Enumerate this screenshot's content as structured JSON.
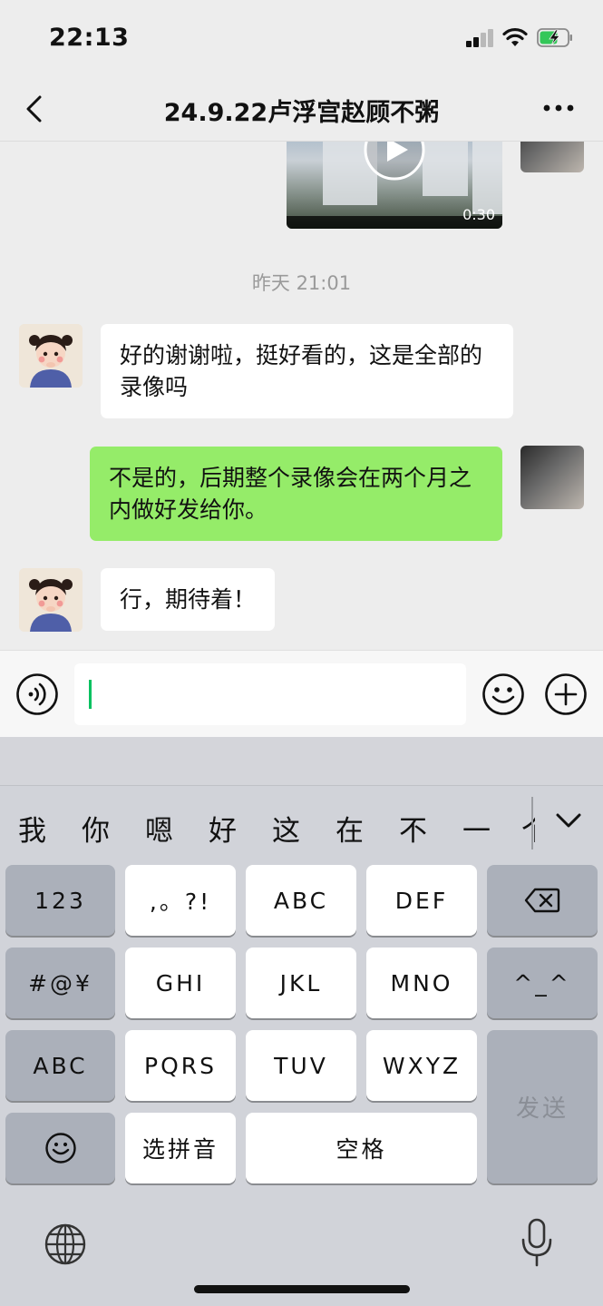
{
  "status_bar": {
    "time": "22:13"
  },
  "nav": {
    "title": "24.9.22卢浮宫赵顾不粥"
  },
  "chat": {
    "video": {
      "duration": "0:30"
    },
    "time_divider": "昨天 21:01",
    "messages": [
      {
        "from": "friend",
        "text": "好的谢谢啦，挺好看的，这是全部的录像吗"
      },
      {
        "from": "self",
        "text": "不是的，后期整个录像会在两个月之内做好发给你。"
      },
      {
        "from": "friend",
        "text": "行，期待着！"
      }
    ]
  },
  "input": {
    "value": ""
  },
  "keyboard": {
    "candidates": [
      "我",
      "你",
      "嗯",
      "好",
      "这",
      "在",
      "不",
      "一",
      "个"
    ],
    "keys": {
      "num": "123",
      "punct": ",。?!",
      "abc": "ABC",
      "def": "DEF",
      "symbols": "#@¥",
      "ghi": "GHI",
      "jkl": "JKL",
      "mno": "MNO",
      "kaomoji": "^_^",
      "abc_switch": "ABC",
      "pqrs": "PQRS",
      "tuv": "TUV",
      "wxyz": "WXYZ",
      "send": "发送",
      "pinyin": "选拼音",
      "space": "空格"
    }
  }
}
